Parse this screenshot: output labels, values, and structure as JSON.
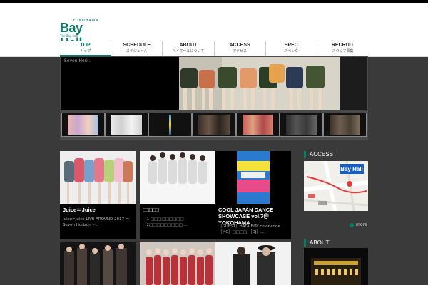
{
  "header": {
    "logo_top": "YOKOHAMA",
    "logo_main": "Bay Hall",
    "logo_sub": "The Bay Hall"
  },
  "nav": [
    {
      "en": "TOP",
      "jp": "トップ"
    },
    {
      "en": "SCHEDULE",
      "jp": "スケジュール"
    },
    {
      "en": "ABOUT",
      "jp": "ベイホールについて"
    },
    {
      "en": "ACCESS",
      "jp": "アクセス"
    },
    {
      "en": "SPEC",
      "jp": "スペック"
    },
    {
      "en": "RECRUIT",
      "jp": "スタッフ募集"
    }
  ],
  "slider": {
    "caption": "Seven Hori..."
  },
  "cards": [
    {
      "title": "Juice＝Juice",
      "desc": "Juice=Juice LIVE AROUND 2017 ～Seven Horizon～..."
    },
    {
      "title": "□□□□□",
      "desc": "［1 □□□□□□□□□ ［2□□□□□□□□□ ..."
    },
    {
      "title": "COOL JAPAN DANCE SHOWCASE vol.7＠YOKOHAMA",
      "desc": "［GUEST］HATA BOY color-code ［MC］□□□□ ［DJ］..."
    }
  ],
  "sidebar": {
    "access_heading": "ACCESS",
    "more_label": "more",
    "about_heading": "ABOUT",
    "map_label": "Bay Hall"
  },
  "colors": {
    "accent": "#0c7a6a",
    "background": "#3a3a3a"
  }
}
